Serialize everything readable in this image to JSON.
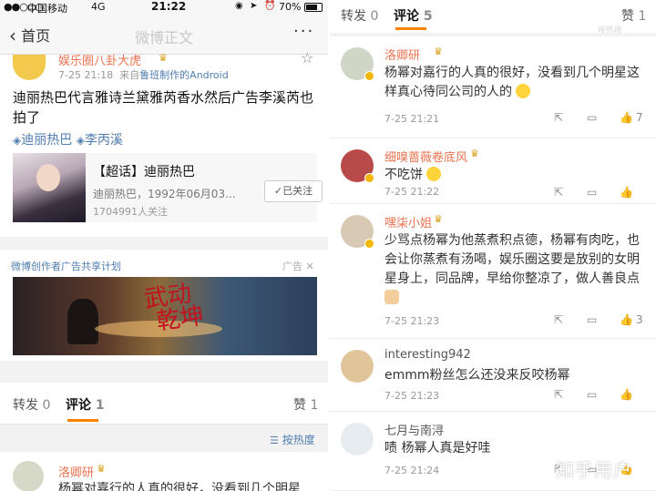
{
  "left": {
    "statusbar": {
      "signal": "●●○○○",
      "carrier": "中国移动",
      "network": "4G",
      "time": "21:22",
      "battery": "70%"
    },
    "nav": {
      "back_label": "首页",
      "title": "微博正文",
      "more": "···"
    },
    "post": {
      "author": "娱乐圈八卦大虎",
      "time": "7-25 21:18",
      "source_prefix": "来自",
      "source": "鲁班制作的Android",
      "text": "迪丽热巴代言雅诗兰黛雅芮香水然后广告李溪芮也拍了",
      "tags": [
        "迪丽热巴",
        "李丙溪"
      ],
      "card": {
        "title": "【超话】迪丽热巴",
        "subtitle": "迪丽热巴，1992年06月03...",
        "count": "1704991人关注",
        "follow_label": "✓已关注"
      }
    },
    "ad": {
      "title": "微博创作者广告共享计划",
      "tag": "广告",
      "close": "✕",
      "banner_text": "武动乾坤"
    },
    "tabs": [
      {
        "label": "转发",
        "count": "0"
      },
      {
        "label": "评论",
        "count": "1"
      },
      {
        "label": "赞",
        "count": "1"
      }
    ],
    "sort_label": "按热度",
    "comment": {
      "name": "洛卿研",
      "text": "杨幂对嘉行的人真的很好，没看到几个明星"
    }
  },
  "right": {
    "tabs": [
      {
        "label": "转发",
        "count": "0"
      },
      {
        "label": "评论",
        "count": "5"
      },
      {
        "label": "赞",
        "count": "1"
      }
    ],
    "ghost_text": "按热度",
    "comments": [
      {
        "name": "洛卿研",
        "text": "杨幂对嘉行的人真的很好，没看到几个明星这样真心待同公司的人的",
        "time": "7-25 21:21",
        "likes": "7",
        "avatar_color": "#cfd6c6",
        "emoji": "face"
      },
      {
        "name": "细嗅蔷薇卷底风",
        "text": "不吃饼",
        "time": "7-25 21:22",
        "likes": "",
        "avatar_color": "#b94a4a",
        "emoji": "face"
      },
      {
        "name": "嘿柒小姐",
        "text": "少骂点杨幂为他蒸煮积点德，杨幂有肉吃，也会让你蒸煮有汤喝，娱乐圈这要是放别的女明星身上，同品牌，早给你整凉了，做人善良点",
        "time": "7-25 21:23",
        "likes": "3",
        "avatar_color": "#d8c9b4",
        "emoji": "hand"
      },
      {
        "name": "interesting942",
        "text": "emmm粉丝怎么还没来反咬杨幂",
        "time": "7-25 21:23",
        "likes": "",
        "avatar_color": "#e0c59a",
        "emoji": ""
      },
      {
        "name": "七月与南浔",
        "text": "啧 杨幂人真是好哇",
        "time": "7-25 21:24",
        "likes": "",
        "avatar_color": "#e6ecef",
        "emoji": ""
      }
    ]
  },
  "watermark": "知乎用户",
  "colors": {
    "accent": "#ff8200",
    "name": "#eb7350",
    "link": "#507daf"
  }
}
